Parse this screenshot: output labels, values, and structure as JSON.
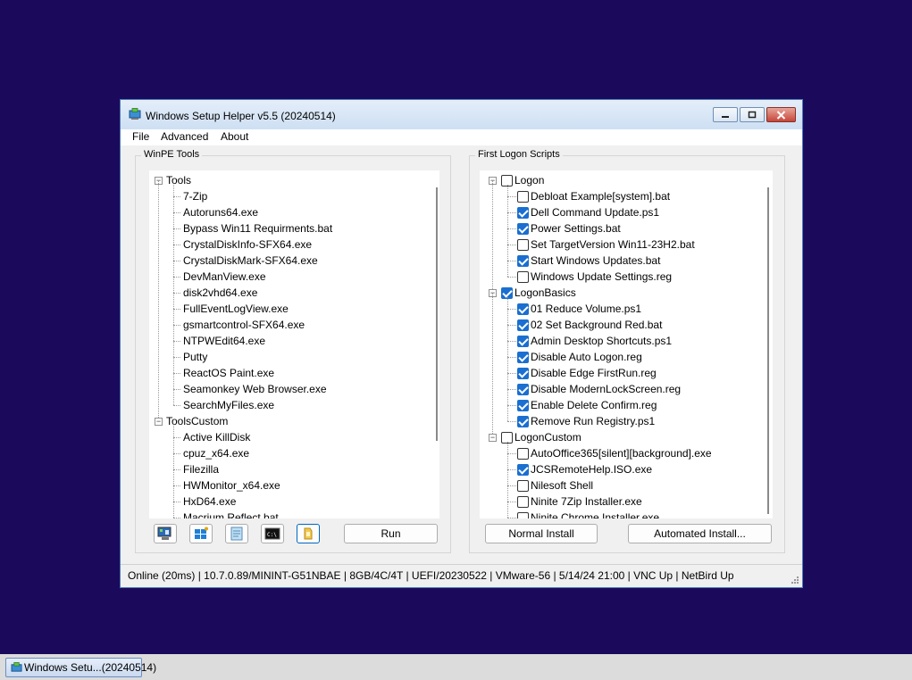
{
  "window": {
    "title": "Windows Setup Helper v5.5 (20240514)",
    "minimize_icon": "minimize-icon",
    "maximize_icon": "maximize-icon",
    "close_icon": "close-icon"
  },
  "menu": [
    "File",
    "Advanced",
    "About"
  ],
  "winpe": {
    "label": "WinPE Tools",
    "tree": [
      {
        "text": "Tools",
        "level": 0,
        "expanded": true
      },
      {
        "text": "7-Zip",
        "level": 1
      },
      {
        "text": "Autoruns64.exe",
        "level": 1
      },
      {
        "text": "Bypass Win11 Requirments.bat",
        "level": 1
      },
      {
        "text": "CrystalDiskInfo-SFX64.exe",
        "level": 1
      },
      {
        "text": "CrystalDiskMark-SFX64.exe",
        "level": 1
      },
      {
        "text": "DevManView.exe",
        "level": 1
      },
      {
        "text": "disk2vhd64.exe",
        "level": 1
      },
      {
        "text": "FullEventLogView.exe",
        "level": 1
      },
      {
        "text": "gsmartcontrol-SFX64.exe",
        "level": 1
      },
      {
        "text": "NTPWEdit64.exe",
        "level": 1
      },
      {
        "text": "Putty",
        "level": 1
      },
      {
        "text": "ReactOS Paint.exe",
        "level": 1
      },
      {
        "text": "Seamonkey Web Browser.exe",
        "level": 1
      },
      {
        "text": "SearchMyFiles.exe",
        "level": 1
      },
      {
        "text": "ToolsCustom",
        "level": 0,
        "expanded": true
      },
      {
        "text": "Active KillDisk",
        "level": 1
      },
      {
        "text": "cpuz_x64.exe",
        "level": 1
      },
      {
        "text": "Filezilla",
        "level": 1
      },
      {
        "text": "HWMonitor_x64.exe",
        "level": 1
      },
      {
        "text": "HxD64.exe",
        "level": 1
      },
      {
        "text": "Macrium Reflect.bat",
        "level": 1
      }
    ],
    "tool_buttons": [
      {
        "name": "computer-management-button",
        "icon": "computer-management-icon"
      },
      {
        "name": "windows-setup-button",
        "icon": "windows-logo-icon"
      },
      {
        "name": "notepad-button",
        "icon": "notepad-icon"
      },
      {
        "name": "command-prompt-button",
        "icon": "command-prompt-icon"
      },
      {
        "name": "explorer-button",
        "icon": "folder-icon"
      }
    ],
    "run_label": "Run"
  },
  "logon": {
    "label": "First Logon Scripts",
    "tree": [
      {
        "text": "Logon",
        "level": 0,
        "checked": false
      },
      {
        "text": "Debloat Example[system].bat",
        "level": 1,
        "checked": false
      },
      {
        "text": "Dell Command Update.ps1",
        "level": 1,
        "checked": true
      },
      {
        "text": "Power Settings.bat",
        "level": 1,
        "checked": true
      },
      {
        "text": "Set TargetVersion Win11-23H2.bat",
        "level": 1,
        "checked": false
      },
      {
        "text": "Start Windows Updates.bat",
        "level": 1,
        "checked": true
      },
      {
        "text": "Windows Update Settings.reg",
        "level": 1,
        "checked": false
      },
      {
        "text": "LogonBasics",
        "level": 0,
        "checked": true
      },
      {
        "text": "01 Reduce Volume.ps1",
        "level": 1,
        "checked": true
      },
      {
        "text": "02 Set Background Red.bat",
        "level": 1,
        "checked": true
      },
      {
        "text": "Admin Desktop Shortcuts.ps1",
        "level": 1,
        "checked": true
      },
      {
        "text": "Disable Auto Logon.reg",
        "level": 1,
        "checked": true
      },
      {
        "text": "Disable Edge FirstRun.reg",
        "level": 1,
        "checked": true
      },
      {
        "text": "Disable ModernLockScreen.reg",
        "level": 1,
        "checked": true
      },
      {
        "text": "Enable Delete Confirm.reg",
        "level": 1,
        "checked": true
      },
      {
        "text": "Remove Run Registry.ps1",
        "level": 1,
        "checked": true
      },
      {
        "text": "LogonCustom",
        "level": 0,
        "checked": false
      },
      {
        "text": "AutoOffice365[silent][background].exe",
        "level": 1,
        "checked": false
      },
      {
        "text": "JCSRemoteHelp.ISO.exe",
        "level": 1,
        "checked": true
      },
      {
        "text": "Nilesoft Shell",
        "level": 1,
        "checked": false
      },
      {
        "text": "Ninite 7Zip Installer.exe",
        "level": 1,
        "checked": false
      },
      {
        "text": "Ninite Chrome Installer.exe",
        "level": 1,
        "checked": false
      }
    ],
    "normal_install_label": "Normal Install",
    "automated_install_label": "Automated Install..."
  },
  "status": "Online (20ms)  |  10.7.0.89/MININT-G51NBAE  |  8GB/4C/4T  |  UEFI/20230522  |  VMware-56  |  5/14/24 21:00  |  VNC Up  |  NetBird Up",
  "taskbar": {
    "label": "Windows Setu...(20240514)",
    "icon": "app-icon"
  }
}
